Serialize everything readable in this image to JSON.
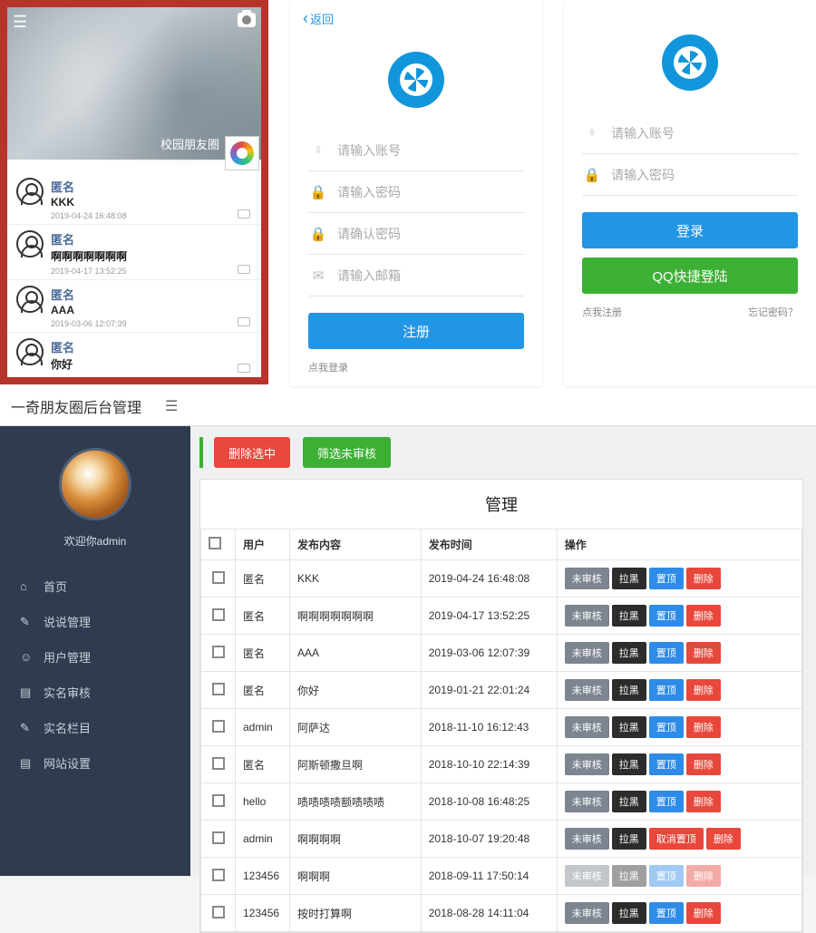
{
  "phone": {
    "hero_label": "校园朋友圈",
    "feed": [
      {
        "name": "匿名",
        "msg": "KKK",
        "time": "2019-04-24 16:48:08"
      },
      {
        "name": "匿名",
        "msg": "啊啊啊啊啊啊啊",
        "time": "2019-04-17 13:52:25"
      },
      {
        "name": "匿名",
        "msg": "AAA",
        "time": "2019-03-06 12:07:39"
      },
      {
        "name": "匿名",
        "msg": "你好",
        "time": ""
      }
    ]
  },
  "register": {
    "back": "返回",
    "account_ph": "请输入账号",
    "password_ph": "请输入密码",
    "confirm_ph": "请确认密码",
    "email_ph": "请输入邮箱",
    "submit": "注册",
    "login_link": "点我登录"
  },
  "login": {
    "account_ph": "请输入账号",
    "password_ph": "请输入密码",
    "submit": "登录",
    "qq": "QQ快捷登陆",
    "reg_link": "点我注册",
    "forgot": "忘记密码？"
  },
  "admin": {
    "title": "一奇朋友圈后台管理",
    "welcome": "欢迎你admin",
    "menu": [
      {
        "icon": "⌂",
        "label": "首页"
      },
      {
        "icon": "✎",
        "label": "说说管理"
      },
      {
        "icon": "☺",
        "label": "用户管理"
      },
      {
        "icon": "▤",
        "label": "实名审核"
      },
      {
        "icon": "✎",
        "label": "实名栏目"
      },
      {
        "icon": "▤",
        "label": "网站设置"
      }
    ],
    "toolbar": {
      "del": "删除选中",
      "filter": "筛选未审核"
    },
    "panel_title": "管理",
    "cols": {
      "user": "用户",
      "content": "发布内容",
      "time": "发布时间",
      "ops": "操作"
    },
    "actions": {
      "review": "未审核",
      "black": "拉黑",
      "top": "置顶",
      "untop": "取消置顶",
      "del": "删除"
    },
    "rows": [
      {
        "user": "匿名",
        "content": "KKK",
        "time": "2019-04-24 16:48:08",
        "top": true
      },
      {
        "user": "匿名",
        "content": "啊啊啊啊啊啊啊",
        "time": "2019-04-17 13:52:25",
        "top": true
      },
      {
        "user": "匿名",
        "content": "AAA",
        "time": "2019-03-06 12:07:39",
        "top": true
      },
      {
        "user": "匿名",
        "content": "你好",
        "time": "2019-01-21 22:01:24",
        "top": true
      },
      {
        "user": "admin",
        "content": "阿萨达",
        "time": "2018-11-10 16:12:43",
        "top": true
      },
      {
        "user": "匿名",
        "content": "阿斯顿撒旦啊",
        "time": "2018-10-10 22:14:39",
        "top": true
      },
      {
        "user": "hello",
        "content": "啧啧啧啧额啧啧啧",
        "time": "2018-10-08 16:48:25",
        "top": true
      },
      {
        "user": "admin",
        "content": "啊啊啊啊",
        "time": "2018-10-07 19:20:48",
        "top": false
      },
      {
        "user": "123456",
        "content": "啊啊啊",
        "time": "2018-09-11 17:50:14",
        "top": true,
        "faded": true
      },
      {
        "user": "123456",
        "content": "按时打算啊",
        "time": "2018-08-28 14:11:04",
        "top": true
      }
    ]
  }
}
